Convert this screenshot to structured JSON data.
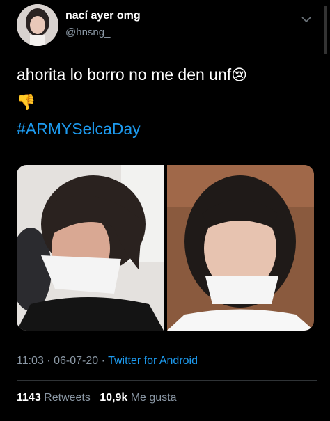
{
  "tweet": {
    "display_name": "nací ayer omg",
    "handle": "@hnsng_",
    "text": "ahorita lo borro no me den unf",
    "emoji_cry": "😢",
    "emoji_thumb": "👎",
    "hashtag": "#ARMYSelcaDay"
  },
  "meta": {
    "time": "11:03",
    "sep1": " · ",
    "date": "06-07-20",
    "sep2": " · ",
    "app": "Twitter for Android"
  },
  "stats": {
    "retweets_count": "1143",
    "retweets_label": "Retweets",
    "likes_count": "10,9k",
    "likes_label": "Me gusta"
  },
  "icons": {
    "more": "chevron-down-icon"
  },
  "colors": {
    "background": "#000000",
    "link": "#1d9bf0",
    "muted": "#8b98a5",
    "divider": "#2f3336"
  }
}
